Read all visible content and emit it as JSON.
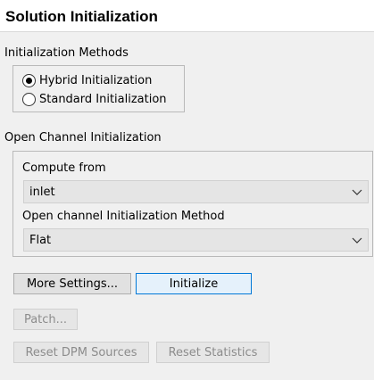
{
  "panel": {
    "title": "Solution Initialization"
  },
  "init_methods": {
    "label": "Initialization Methods",
    "options": [
      {
        "label": "Hybrid  Initialization",
        "selected": true
      },
      {
        "label": "Standard Initialization",
        "selected": false
      }
    ]
  },
  "open_channel": {
    "label": "Open Channel Initialization",
    "compute_from": {
      "label": "Compute from",
      "value": "inlet"
    },
    "method": {
      "label": "Open channel Initialization Method",
      "value": "Flat"
    }
  },
  "buttons": {
    "more_settings": "More Settings...",
    "initialize": "Initialize",
    "patch": "Patch...",
    "reset_dpm": "Reset DPM Sources",
    "reset_statistics": "Reset Statistics"
  },
  "icons": {
    "dropdown": "chevron-down-icon"
  },
  "colors": {
    "accent": "#0078d7",
    "background": "#f0f0f0"
  }
}
